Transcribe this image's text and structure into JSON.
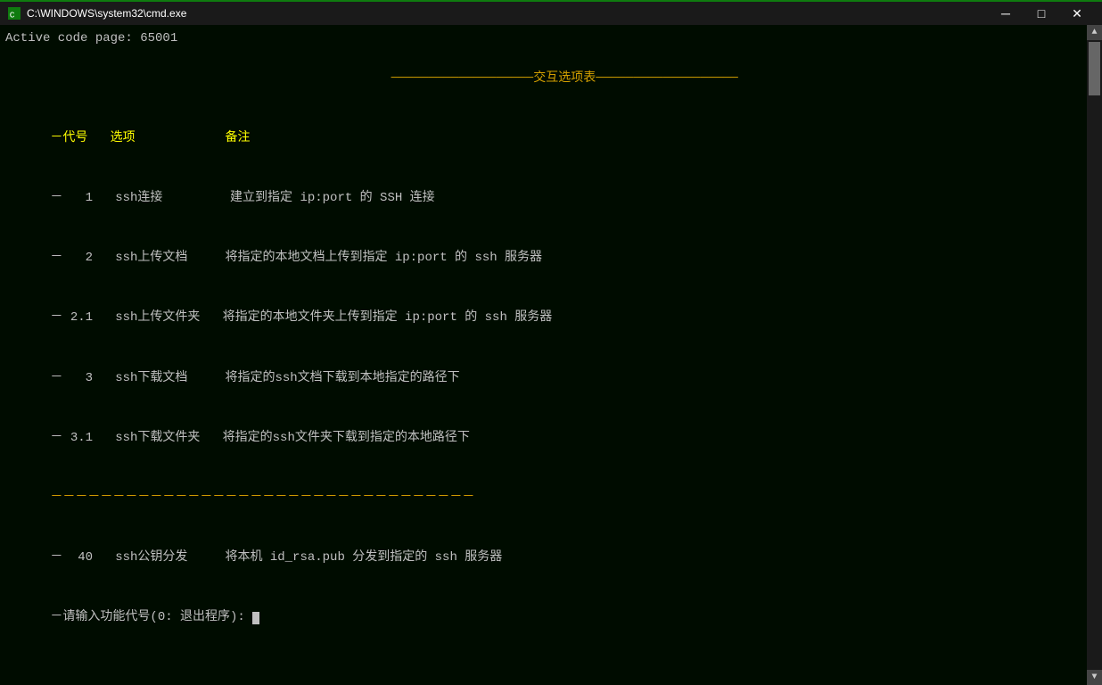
{
  "titlebar": {
    "icon_label": "cmd-icon",
    "title": "C:\\WINDOWS\\system32\\cmd.exe",
    "minimize_label": "─",
    "maximize_label": "□",
    "close_label": "✕"
  },
  "terminal": {
    "active_code_page": "Active code page: 65001",
    "menu_title": "───────────────────交互选项表───────────────────",
    "header_code": "－代号",
    "header_option": "选项",
    "header_note": "备注",
    "rows": [
      {
        "code": "－   1",
        "option": "ssh连接",
        "note": "建立到指定 ip:port 的 SSH 连接"
      },
      {
        "code": "－   2",
        "option": "ssh上传文档",
        "note": "将指定的本地文档上传到指定 ip:port 的 ssh 服务器"
      },
      {
        "code": "－ 2.1",
        "option": "ssh上传文件夹",
        "note": "将指定的本地文件夹上传到指定 ip:port 的 ssh 服务器"
      },
      {
        "code": "－   3",
        "option": "ssh下载文档",
        "note": "将指定的ssh文档下载到本地指定的路径下"
      },
      {
        "code": "－ 3.1",
        "option": "ssh下载文件夹",
        "note": "将指定的ssh文件夹下载到指定的本地路径下"
      }
    ],
    "separator": "－－－－－－－－－－－－－－－－－－－－－－－－－－－－－－－－－－",
    "row_40_code": "－  40",
    "row_40_option": "ssh公钥分发",
    "row_40_note": "将本机 id_rsa.pub 分发到指定的 ssh 服务器",
    "prompt": "－请输入功能代号(0: 退出程序): "
  }
}
